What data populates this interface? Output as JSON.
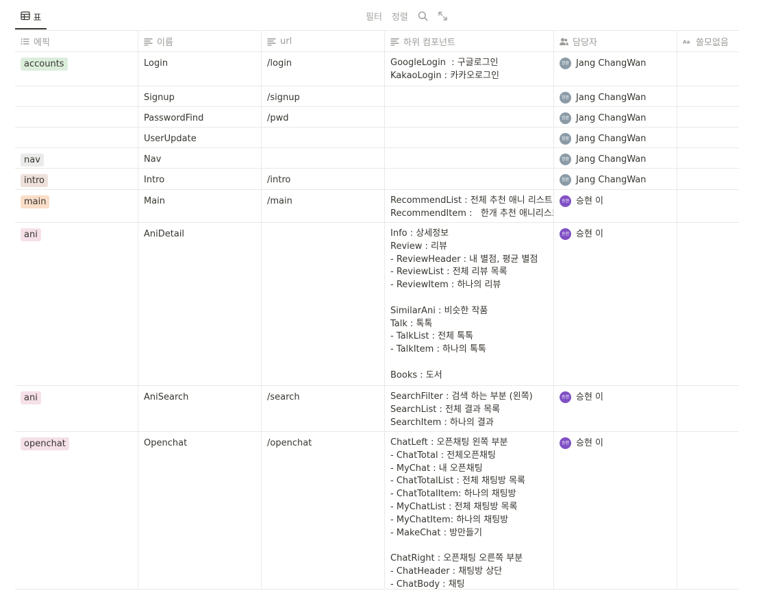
{
  "toolbar": {
    "view_tab": "표",
    "filter": "필터",
    "sort": "정렬",
    "search_icon": "search-icon",
    "expand_icon": "expand-icon"
  },
  "columns": [
    {
      "label": "에픽",
      "icon": "list-icon"
    },
    {
      "label": "이름",
      "icon": "text-icon"
    },
    {
      "label": "url",
      "icon": "text-icon"
    },
    {
      "label": "하위 컴포넌트",
      "icon": "text-icon"
    },
    {
      "label": "담당자",
      "icon": "people-icon"
    },
    {
      "label": "쓸모없음",
      "icon": "title-icon"
    }
  ],
  "people": {
    "jang": {
      "name": "Jang ChangWan",
      "initials": "창완",
      "color": "#8a9aa6"
    },
    "lee": {
      "name": "승현 이",
      "initials": "승현",
      "color": "#7f4fc4"
    }
  },
  "rows": [
    {
      "epic": "accounts",
      "epic_bg": "#dbeddb",
      "name": "Login",
      "url": "/login",
      "sub": "GoogleLogin  : 구글로그인\nKakaoLogin : 카카오로그인",
      "owner": "jang",
      "h": 50
    },
    {
      "epic": "",
      "epic_bg": "",
      "name": "Signup",
      "url": "/signup",
      "sub": "",
      "owner": "jang",
      "h": 30
    },
    {
      "epic": "",
      "epic_bg": "",
      "name": "PasswordFind",
      "url": "/pwd",
      "sub": "",
      "owner": "jang",
      "h": 30
    },
    {
      "epic": "",
      "epic_bg": "",
      "name": "UserUpdate",
      "url": "",
      "sub": "",
      "owner": "jang",
      "h": 30
    },
    {
      "epic": "nav",
      "epic_bg": "#ebebea",
      "name": "Nav",
      "url": "",
      "sub": "",
      "owner": "jang",
      "h": 30
    },
    {
      "epic": "intro",
      "epic_bg": "#eee0da",
      "name": "Intro",
      "url": "/intro",
      "sub": "",
      "owner": "jang",
      "h": 31
    },
    {
      "epic": "main",
      "epic_bg": "#fadec9",
      "name": "Main",
      "url": "/main",
      "sub": "RecommendList : 전체 추천 애니 리스트\nRecommendItem :   한개 추천 애니리스트",
      "owner": "lee",
      "h": 48
    },
    {
      "epic": "ani",
      "epic_bg": "#f5e0e9",
      "name": "AniDetail",
      "url": "",
      "sub": "Info : 상세정보\nReview : 리뷰\n- ReviewHeader : 내 별점, 평균 별점\n- ReviewList : 전체 리뷰 목록\n- ReviewItem : 하나의 리뷰\n\nSimilarAni : 비슷한 작품\nTalk : 톡톡\n- TalkList : 전체 톡톡\n- TalkItem : 하나의 톡톡\n\nBooks : 도서",
      "owner": "lee",
      "h": 238
    },
    {
      "epic": "ani",
      "epic_bg": "#f5e0e9",
      "name": "AniSearch",
      "url": "/search",
      "sub": "SearchFilter : 검색 하는 부분 (왼쪽)\nSearchList : 전체 결과 목록\nSearchItem : 하나의 결과",
      "owner": "lee",
      "h": 67
    },
    {
      "epic": "openchat",
      "epic_bg": "#f5e0e9",
      "name": "Opencha t",
      "url": "/openchat",
      "sub": "ChatLeft : 오픈채팅 왼쪽 부분\n- ChatTotal : 전체오픈채팅\n- MyChat : 내 오픈채팅\n- ChatTotalList : 전체 채팅방 목록\n- ChatTotalItem: 하나의 채팅방\n- MyChatList : 전체 채팅방 목록\n- MyChatItem: 하나의 채팅방\n- MakeChat : 방만들기\n\nChatRight : 오픈채팅 오른쪽 부분\n- ChatHeader : 채팅방 상단\n- ChatBody : 채팅",
      "owner": "lee",
      "h": 230
    }
  ]
}
